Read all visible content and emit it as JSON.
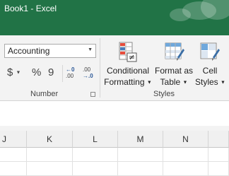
{
  "window": {
    "title": "Book1 - Excel"
  },
  "ribbon": {
    "number_group": {
      "format_value": "Accounting",
      "currency_symbol": "$",
      "percent_symbol": "%",
      "comma_symbol": "9",
      "increase_decimal": {
        "top": "←0",
        "bottom": ".00"
      },
      "decrease_decimal": {
        "top": ".00",
        "bottom": "→.0"
      },
      "label": "Number"
    },
    "styles_group": {
      "conditional_formatting": {
        "line1": "Conditional",
        "line2": "Formatting"
      },
      "format_as_table": {
        "line1": "Format as",
        "line2": "Table"
      },
      "cell_styles": {
        "line1": "Cell",
        "line2": "Styles"
      },
      "label": "Styles"
    }
  },
  "grid": {
    "columns": [
      "J",
      "K",
      "L",
      "M",
      "N"
    ]
  },
  "colors": {
    "title_bar": "#217346",
    "ribbon": "#f3f3f3",
    "header": "#f0f0f0"
  }
}
